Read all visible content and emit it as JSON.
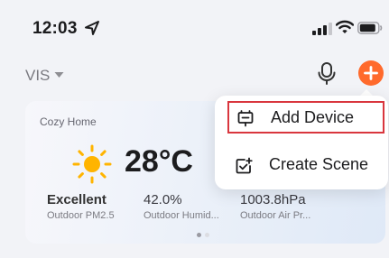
{
  "status_bar": {
    "time": "12:03",
    "icons": [
      "location-arrow-icon",
      "cellular-signal-icon",
      "wifi-icon",
      "battery-icon"
    ]
  },
  "header": {
    "home_name": "VIS",
    "icons": [
      "chevron-down-icon",
      "microphone-icon",
      "add-icon"
    ]
  },
  "weather_card": {
    "title": "Cozy Home",
    "weather_icon": "sun-icon",
    "temperature": "28°C",
    "metrics": [
      {
        "value": "Excellent",
        "label": "Outdoor PM2.5"
      },
      {
        "value": "42.0%",
        "label": "Outdoor Humid..."
      },
      {
        "value": "1003.8hPa",
        "label": "Outdoor Air Pr..."
      }
    ],
    "page_indicator": {
      "pages": 2,
      "current": 1
    }
  },
  "popup_menu": {
    "items": [
      {
        "label": "Add Device",
        "icon": "add-device-icon",
        "highlighted": true
      },
      {
        "label": "Create Scene",
        "icon": "create-scene-icon",
        "highlighted": false
      }
    ]
  },
  "colors": {
    "accent": "#ff6a2c",
    "highlight_border": "#d9363e",
    "sun": "#ffb400",
    "background": "#f2f3f7"
  }
}
